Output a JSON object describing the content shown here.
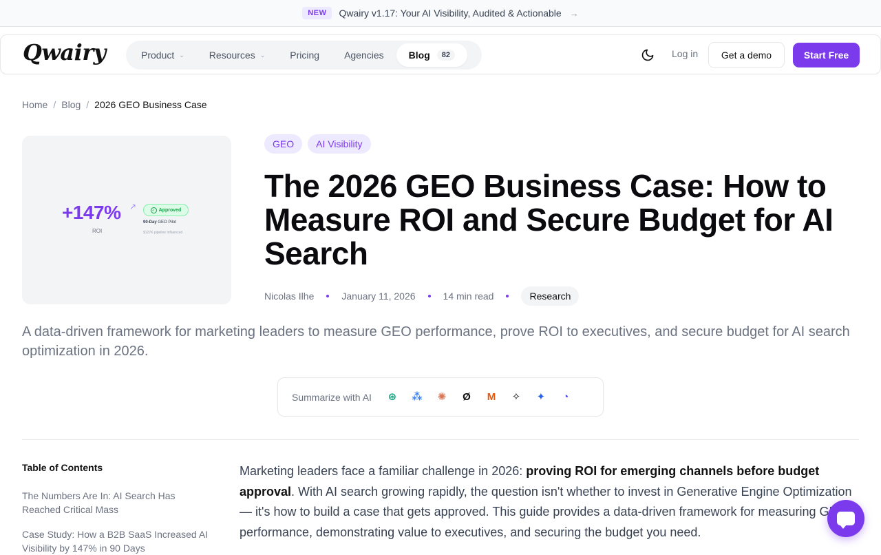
{
  "announcement": {
    "badge": "NEW",
    "text": "Qwairy v1.17: Your AI Visibility, Audited & Actionable",
    "arrow": "→"
  },
  "header": {
    "logo": "Qwairy",
    "nav": [
      {
        "label": "Product",
        "dropdown": true
      },
      {
        "label": "Resources",
        "dropdown": true
      },
      {
        "label": "Pricing"
      },
      {
        "label": "Agencies"
      },
      {
        "label": "Blog",
        "count": "82",
        "active": true
      }
    ],
    "theme_icon": "moon-icon",
    "login": "Log in",
    "demo": "Get a demo",
    "start": "Start Free"
  },
  "breadcrumb": {
    "home": "Home",
    "blog": "Blog",
    "current": "2026 GEO Business Case",
    "sep": "/"
  },
  "hero_image": {
    "roi": "+147%",
    "roi_label": "ROI",
    "approved": "Approved",
    "pilot_bold": "90-Day",
    "pilot_rest": "GEO Pilot",
    "pipeline": "$127K pipeline influenced"
  },
  "tags": [
    "GEO",
    "AI Visibility"
  ],
  "article": {
    "title": "The 2026 GEO Business Case: How to Measure ROI and Secure Budget for AI Search",
    "author": "Nicolas Ilhe",
    "date": "January 11, 2026",
    "read_time": "14 min read",
    "category": "Research",
    "lead": "A data-driven framework for marketing leaders to measure GEO performance, prove ROI to executives, and secure budget for AI search optimization in 2026."
  },
  "summarize": {
    "label": "Summarize with AI",
    "icons": [
      {
        "name": "chatgpt-icon",
        "glyph": "⊛",
        "color": "#10a37f"
      },
      {
        "name": "claude-icon",
        "glyph": "⁂",
        "color": "#3b82f6"
      },
      {
        "name": "anthropic-icon",
        "glyph": "✺",
        "color": "#d97757"
      },
      {
        "name": "perplexity-icon",
        "glyph": "Ø",
        "color": "#111111"
      },
      {
        "name": "mistral-icon",
        "glyph": "M",
        "color": "#ea580c"
      },
      {
        "name": "grok-icon",
        "glyph": "✧",
        "color": "#111111"
      },
      {
        "name": "gemini-icon",
        "glyph": "✦",
        "color": "#2563eb"
      },
      {
        "name": "deepseek-icon",
        "glyph": "◔",
        "color": "#4f46e5"
      }
    ]
  },
  "toc": {
    "title": "Table of Contents",
    "items": [
      "The Numbers Are In: AI Search Has Reached Critical Mass",
      "Case Study: How a B2B SaaS Increased AI Visibility by 147% in 90 Days"
    ]
  },
  "body": {
    "p1_start": "Marketing leaders face a familiar challenge in 2026: ",
    "p1_bold": "proving ROI for emerging channels before budget approval",
    "p1_end": ". With AI search growing rapidly, the question isn't whether to invest in Generative Engine Optimization — it's how to build a case that gets approved. This guide provides a data-driven framework for measuring GEO performance, demonstrating value to executives, and securing the budget you need."
  },
  "colors": {
    "accent": "#7c3aed",
    "accent_light": "#ede9fe",
    "success": "#16a34a"
  }
}
